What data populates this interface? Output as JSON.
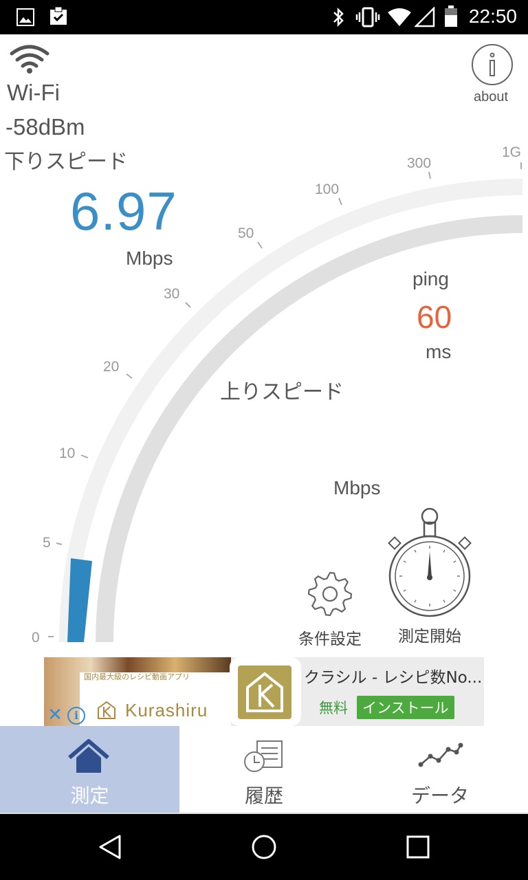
{
  "status_bar": {
    "time": "22:50"
  },
  "network": {
    "type": "Wi-Fi",
    "signal": "-58dBm"
  },
  "download": {
    "label": "下りスピード",
    "value": "6.97",
    "unit": "Mbps"
  },
  "ping": {
    "label": "ping",
    "value": "60",
    "unit": "ms"
  },
  "upload": {
    "label": "上りスピード",
    "unit": "Mbps"
  },
  "about": {
    "label": "about"
  },
  "gauge": {
    "ticks": [
      "0",
      "5",
      "10",
      "20",
      "30",
      "50",
      "100",
      "300",
      "1G"
    ],
    "download_level": "6.97"
  },
  "actions": {
    "settings_label": "条件設定",
    "start_label": "測定開始"
  },
  "ad": {
    "tagline": "国内最大級のレシピ動画アプリ",
    "brand": "Kurashiru",
    "title": "クラシル - レシピ数No...",
    "price": "無料",
    "install": "インストール"
  },
  "tabs": [
    {
      "label": "測定",
      "icon": "home-icon"
    },
    {
      "label": "履歴",
      "icon": "history-icon"
    },
    {
      "label": "データ",
      "icon": "chart-icon"
    }
  ],
  "colors": {
    "accent": "#3a8fc7",
    "ping": "#e8623a",
    "active_tab": "#bac8e4"
  }
}
